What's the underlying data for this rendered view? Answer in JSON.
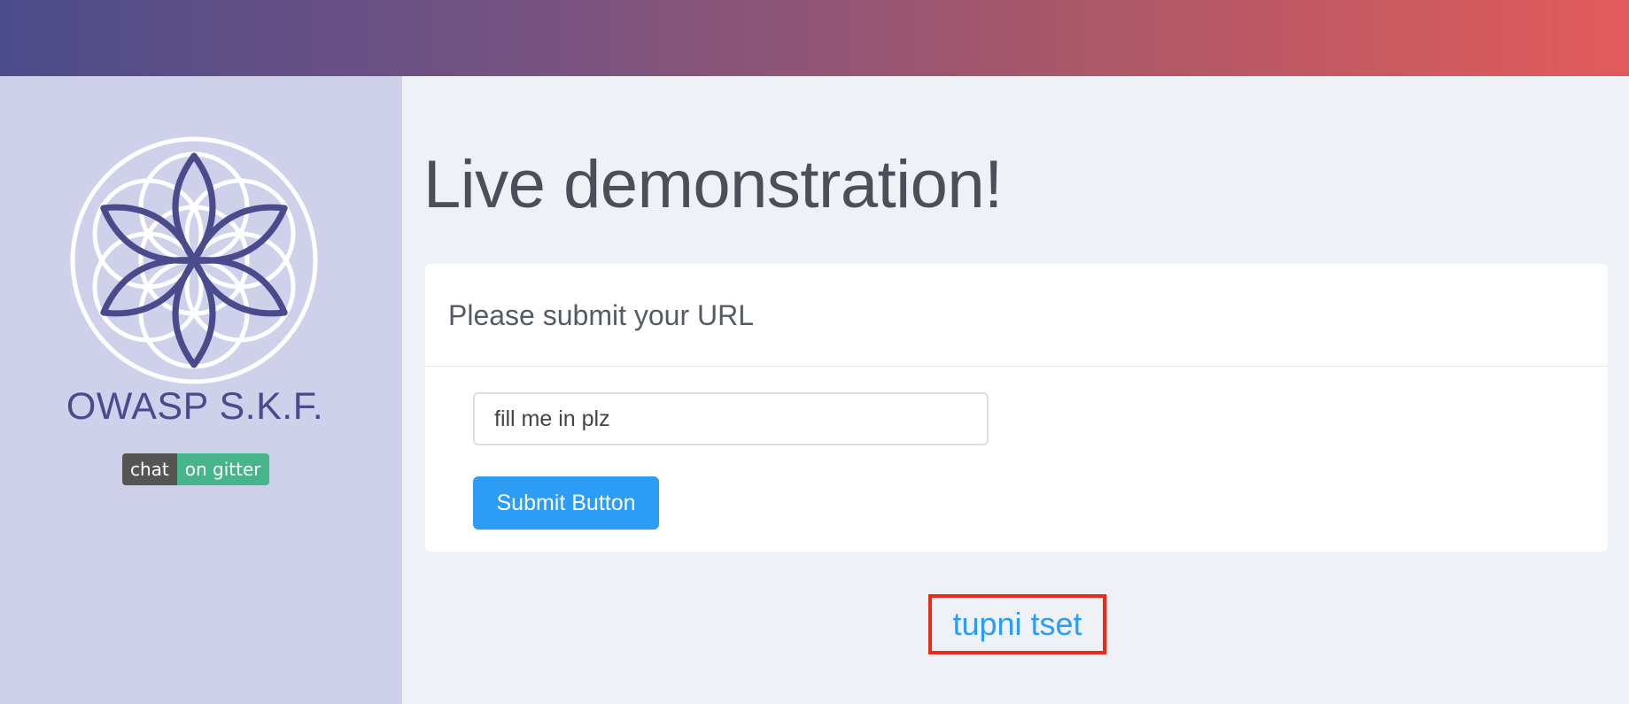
{
  "brand": {
    "name": "OWASP S.K.F.",
    "badge": {
      "left": "chat",
      "right": "on gitter"
    }
  },
  "page": {
    "title": "Live demonstration!"
  },
  "form": {
    "card_title": "Please submit your URL",
    "input_value": "fill me in plz",
    "submit_label": "Submit Button"
  },
  "link": {
    "label": "tupni tset"
  },
  "icons": {
    "logo": "owasp-skf-flower-logo"
  },
  "colors": {
    "accent": "#2d9cf5",
    "highlight_border": "#ec2a18",
    "brand_text": "#4a4a8c",
    "sidebar_bg": "#cfd1eb"
  }
}
